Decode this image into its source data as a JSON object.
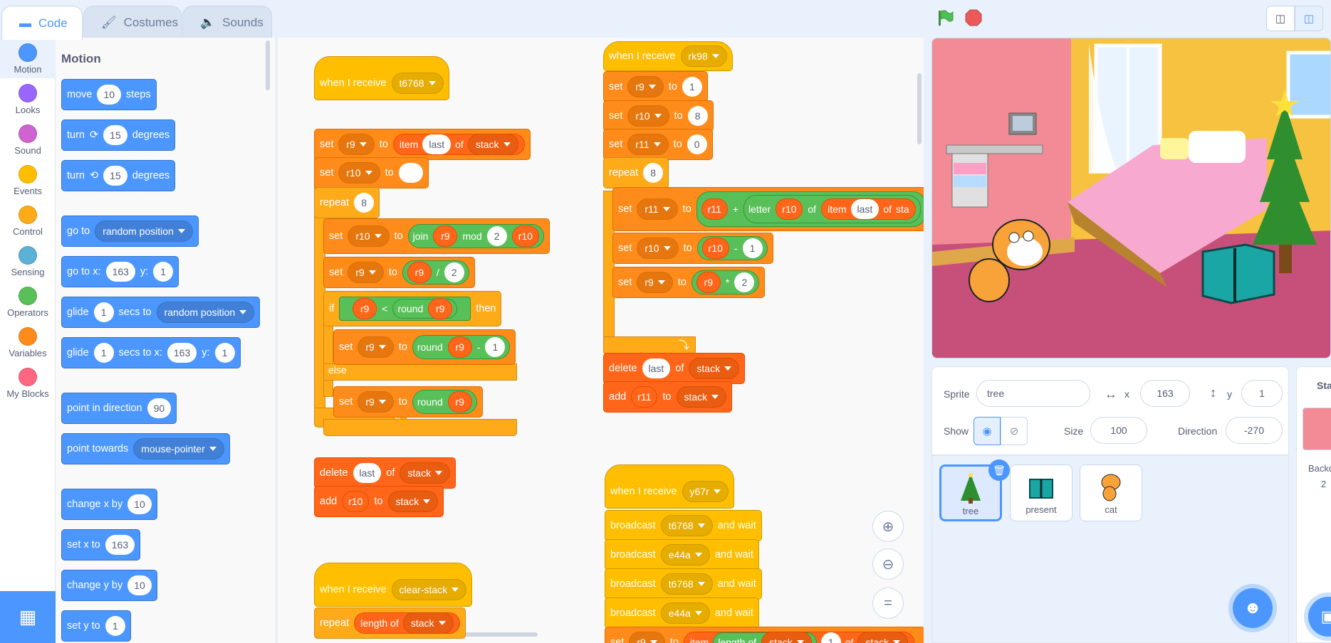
{
  "tabs": {
    "code": "Code",
    "costumes": "Costumes",
    "sounds": "Sounds"
  },
  "categories": [
    "Motion",
    "Looks",
    "Sound",
    "Events",
    "Control",
    "Sensing",
    "Operators",
    "Variables",
    "My Blocks"
  ],
  "category_colors": [
    "#4c97ff",
    "#9966ff",
    "#cf63cf",
    "#ffbf00",
    "#ffab19",
    "#5cb1d6",
    "#59c059",
    "#ff8c1a",
    "#ff6680"
  ],
  "palette": {
    "title": "Motion",
    "move": {
      "a": "move",
      "v": "10",
      "b": "steps"
    },
    "turn_right": {
      "a": "turn",
      "v": "15",
      "b": "degrees"
    },
    "turn_left": {
      "a": "turn",
      "v": "15",
      "b": "degrees"
    },
    "goto": {
      "a": "go to",
      "d": "random position"
    },
    "gotoxy": {
      "a": "go to x:",
      "x": "163",
      "b": "y:",
      "y": "1"
    },
    "glide1": {
      "a": "glide",
      "v": "1",
      "b": "secs to",
      "d": "random position"
    },
    "glide2": {
      "a": "glide",
      "v": "1",
      "b": "secs to x:",
      "x": "163",
      "c": "y:",
      "y": "1"
    },
    "point_dir": {
      "a": "point in direction",
      "v": "90"
    },
    "point_towards": {
      "a": "point towards",
      "d": "mouse-pointer"
    },
    "change_x": {
      "a": "change x by",
      "v": "10"
    },
    "set_x": {
      "a": "set x to",
      "v": "163"
    },
    "change_y": {
      "a": "change y by",
      "v": "10"
    },
    "set_y": {
      "a": "set y to",
      "v": "1"
    }
  },
  "script1": {
    "when": "when I receive",
    "msg": "t6768",
    "s1": {
      "set": "set",
      "var": "r9",
      "to": "to",
      "item": "item",
      "last": "last",
      "of": "of",
      "list": "stack"
    },
    "s2": {
      "set": "set",
      "var": "r10",
      "to": "to"
    },
    "repeat": "repeat",
    "rep_n": "8",
    "s3": {
      "set": "set",
      "var": "r10",
      "to": "to",
      "join": "join",
      "a": "r9",
      "mod": "mod",
      "b": "2",
      "c": "r10"
    },
    "s4": {
      "set": "set",
      "var": "r9",
      "to": "to",
      "a": "r9",
      "op": "/",
      "b": "2"
    },
    "if": "if",
    "cond": {
      "a": "r9",
      "op": "<",
      "round": "round",
      "b": "r9"
    },
    "then": "then",
    "s5": {
      "set": "set",
      "var": "r9",
      "to": "to",
      "round": "round",
      "a": "r9",
      "op": "-",
      "b": "1"
    },
    "else": "else",
    "s6": {
      "set": "set",
      "var": "r9",
      "to": "to",
      "round": "round",
      "a": "r9"
    },
    "del": {
      "a": "delete",
      "last": "last",
      "of": "of",
      "list": "stack"
    },
    "add": {
      "a": "add",
      "v": "r10",
      "to": "to",
      "list": "stack"
    }
  },
  "script2": {
    "when": "when I receive",
    "msg": "rk98",
    "s1": {
      "set": "set",
      "var": "r9",
      "to": "to",
      "v": "1"
    },
    "s2": {
      "set": "set",
      "var": "r10",
      "to": "to",
      "v": "8"
    },
    "s3": {
      "set": "set",
      "var": "r11",
      "to": "to",
      "v": "0"
    },
    "repeat": "repeat",
    "rep_n": "8",
    "s4": {
      "set": "set",
      "var": "r11",
      "to": "to",
      "a": "r11",
      "op": "+",
      "letter": "letter",
      "b": "r10",
      "of": "of",
      "item": "item",
      "last": "last",
      "of2": "of",
      "list": "sta"
    },
    "s5": {
      "set": "set",
      "var": "r10",
      "to": "to",
      "a": "r10",
      "op": "-",
      "b": "1"
    },
    "s6": {
      "set": "set",
      "var": "r9",
      "to": "to",
      "a": "r9",
      "op": "*",
      "b": "2"
    },
    "del": {
      "a": "delete",
      "last": "last",
      "of": "of",
      "list": "stack"
    },
    "add": {
      "a": "add",
      "v": "r11",
      "to": "to",
      "list": "stack"
    }
  },
  "script3": {
    "when": "when I receive",
    "msg": "y67r",
    "b1": {
      "a": "broadcast",
      "msg": "t6768",
      "b": "and wait"
    },
    "b2": {
      "a": "broadcast",
      "msg": "e44a",
      "b": "and wait"
    },
    "b3": {
      "a": "broadcast",
      "msg": "t6768",
      "b": "and wait"
    },
    "b4": {
      "a": "broadcast",
      "msg": "e44a",
      "b": "and wait"
    },
    "s1": {
      "set": "set",
      "var": "r9",
      "to": "to",
      "item": "item",
      "len": "length of",
      "list": "stack",
      "v": "1",
      "of": "of",
      "list2": "stack"
    }
  },
  "script4": {
    "when": "when I receive",
    "msg": "clear-stack",
    "repeat": "repeat",
    "len": "length of",
    "list": "stack"
  },
  "sprite_info": {
    "sprite_label": "Sprite",
    "name": "tree",
    "x_label": "x",
    "x": "163",
    "y_label": "y",
    "y": "1",
    "show_label": "Show",
    "size_label": "Size",
    "size": "100",
    "direction_label": "Direction",
    "direction": "-270"
  },
  "sprites": [
    {
      "name": "tree"
    },
    {
      "name": "present"
    },
    {
      "name": "cat"
    }
  ],
  "stage_pane": {
    "label": "Stag",
    "backdrops": "Backd",
    "count": "2"
  }
}
